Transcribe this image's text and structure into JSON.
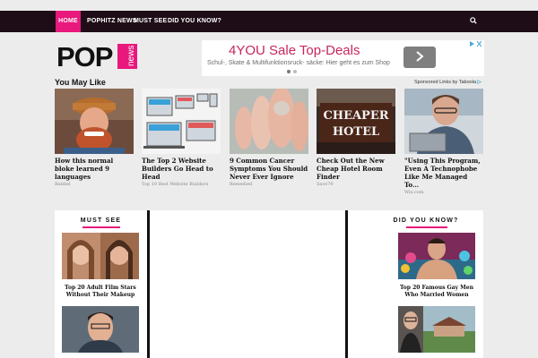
{
  "nav": {
    "items": [
      "HOME",
      "POPHITZ NEWS",
      "MUST SEE",
      "DID YOU KNOW?"
    ],
    "search_icon": "search-icon"
  },
  "logo": {
    "main": "POP",
    "side": "news"
  },
  "ad": {
    "title": "4YOU Sale Top-Deals",
    "subtitle": "Schul-, Skate & Multifunktionsruck- säcke: Hier geht es zum Shop",
    "button_icon": "chevron-right-icon",
    "info_icon": "adchoices-icon"
  },
  "you_may_like": {
    "title": "You May Like",
    "sponsored": "Sponsored Links by Taboola",
    "cards": [
      {
        "title": "How this normal bloke learned 9 languages",
        "source": "Babbel"
      },
      {
        "title": "The Top 2 Website Builders Go Head to Head",
        "source": "Top 10 Best Website Builders"
      },
      {
        "title": "9 Common Cancer Symptoms You Should Never Ever Ignore",
        "source": "Remedied"
      },
      {
        "title": "Check Out the New Cheap Hotel Room Finder",
        "source": "Save70"
      },
      {
        "title": "\"Using This Program, Even A Technophobe Like Me Managed To…",
        "source": "Wix.com"
      }
    ],
    "hotel_sign": [
      "CHEAPER",
      "HOTEL"
    ]
  },
  "must_see": {
    "title": "MUST SEE",
    "items": [
      {
        "caption": "Top 20 Adult Film Stars Without Their Makeup"
      },
      {
        "caption": ""
      }
    ]
  },
  "did_you_know": {
    "title": "DID YOU KNOW?",
    "items": [
      {
        "caption": "Top 20 Famous Gay Men Who Married Women"
      },
      {
        "caption": ""
      }
    ]
  },
  "colors": {
    "accent": "#e8187c",
    "nav_bg": "#1e0d17",
    "ad_title": "#c8255e"
  }
}
